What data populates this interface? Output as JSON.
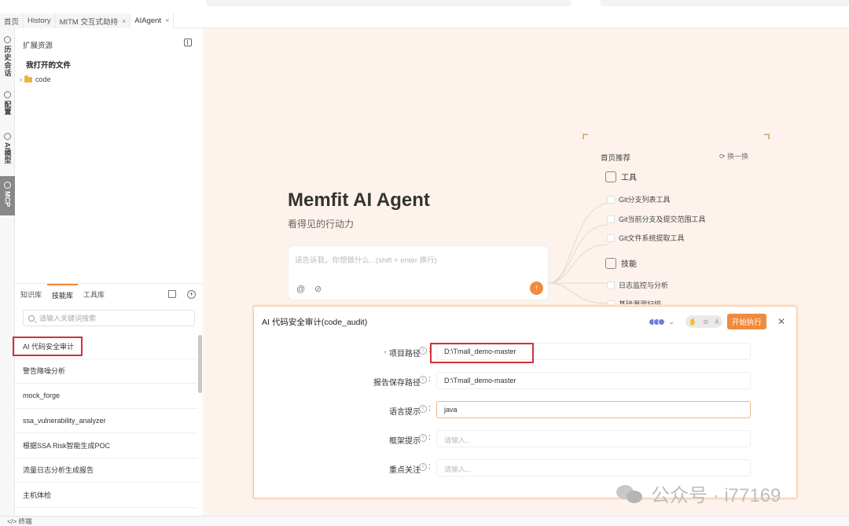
{
  "tabs": [
    {
      "label": "首页",
      "closable": false,
      "active": false
    },
    {
      "label": "History",
      "closable": false,
      "active": false
    },
    {
      "label": "MITM 交互式劫持",
      "closable": true,
      "active": false
    },
    {
      "label": "AIAgent",
      "closable": true,
      "active": true
    }
  ],
  "rail": {
    "history": "历史会话",
    "config": "配置",
    "model": "AI模型",
    "mcp": "MCP"
  },
  "sidebar": {
    "title": "扩展资源",
    "files_title": "我打开的文件",
    "folder": "code",
    "kb_tabs": [
      "知识库",
      "技能库",
      "工具库"
    ],
    "active_kb_tab": 1,
    "search_placeholder": "请输入关键词搜索",
    "skills": [
      "AI 代码安全审计",
      "警告降噪分析",
      "mock_forge",
      "ssa_vulnerability_analyzer",
      "根据SSA Risk智能生成POC",
      "流量日志分析生成报告",
      "主机体检"
    ]
  },
  "hero": {
    "title": "Memfit AI Agent",
    "subtitle": "看得见的行动力"
  },
  "chat": {
    "placeholder": "请告诉我，你想做什么...(shift + enter 换行)"
  },
  "recommend": {
    "title": "首页推荐",
    "refresh": "换一换",
    "tools_label": "工具",
    "tools": [
      "Git分支列表工具",
      "Git当前分支及提交范围工具",
      "Git文件系统提取工具"
    ],
    "skills_label": "技能",
    "skills": [
      "日志监控与分析",
      "基础漏洞扫描"
    ]
  },
  "dialog": {
    "title": "AI 代码安全审计(code_audit)",
    "run_label": "开始执行",
    "fields": [
      {
        "label": "项目路径",
        "required": true,
        "value": "D:\\Tmall_demo-master",
        "placeholder": ""
      },
      {
        "label": "报告保存路径",
        "required": false,
        "value": "D:\\Tmall_demo-master",
        "placeholder": ""
      },
      {
        "label": "语言提示",
        "required": false,
        "value": "java",
        "placeholder": ""
      },
      {
        "label": "框架提示",
        "required": false,
        "value": "",
        "placeholder": "请输入..."
      },
      {
        "label": "重点关注",
        "required": false,
        "value": "",
        "placeholder": "请输入..."
      }
    ]
  },
  "bottom": {
    "label": "终端"
  },
  "watermark": {
    "text": "公众号 · i77169"
  },
  "colors": {
    "accent": "#f08a3c",
    "highlight_box": "#d0323a",
    "main_bg": "#fdf3ec"
  }
}
